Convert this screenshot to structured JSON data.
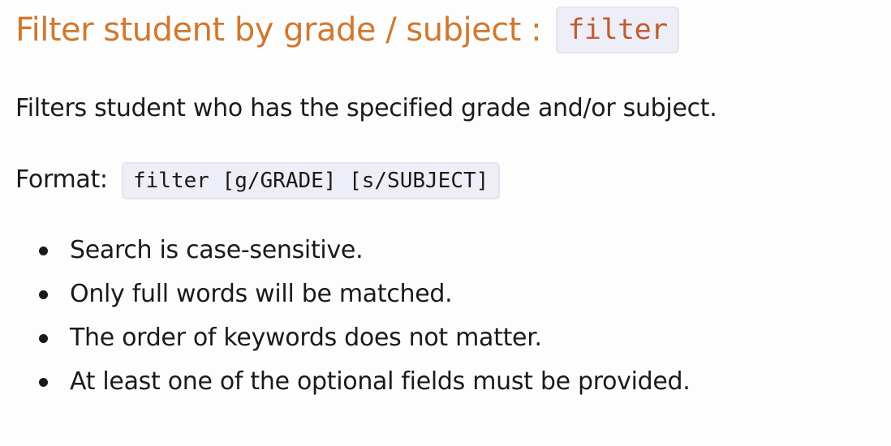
{
  "section": {
    "title": "Filter student by grade / subject :",
    "command": "filter"
  },
  "description": "Filters student who has the specified grade and/or subject.",
  "format": {
    "label": "Format:",
    "code": "filter [g/GRADE] [s/SUBJECT]"
  },
  "notes": [
    "Search is case-sensitive.",
    "Only full words will be matched.",
    "The order of keywords does not matter.",
    "At least one of the optional fields must be provided."
  ]
}
